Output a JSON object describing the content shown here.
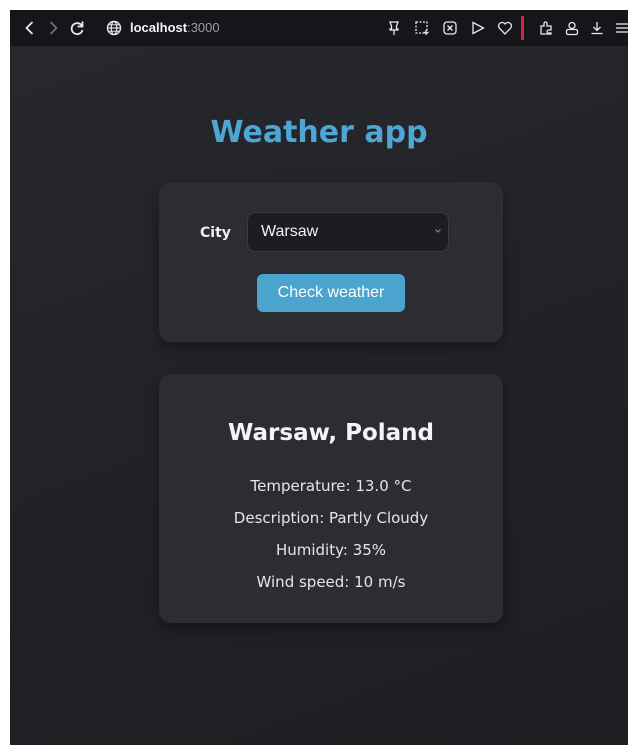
{
  "browser": {
    "url_host": "localhost",
    "url_port": ":3000",
    "accent_color": "#d4273d"
  },
  "app": {
    "title": "Weather app",
    "title_color": "#4ea6d2"
  },
  "form": {
    "city_label": "City",
    "city_selected": "Warsaw",
    "button_label": "Check weather",
    "button_color": "#4ba4cd"
  },
  "result": {
    "title": "Warsaw, Poland",
    "temperature": "Temperature: 13.0 °C",
    "description": "Description: Partly Cloudy",
    "humidity": "Humidity: 35%",
    "wind": "Wind speed: 10 m/s"
  },
  "icons": {
    "back": "chevron-left-icon",
    "forward": "chevron-right-icon",
    "reload": "reload-icon",
    "site": "globe-icon",
    "toolbar": [
      "pin-icon",
      "screenshot-icon",
      "shield-icon",
      "play-icon",
      "heart-icon",
      "extensions-icon",
      "account-icon",
      "download-icon",
      "menu-icon"
    ]
  }
}
